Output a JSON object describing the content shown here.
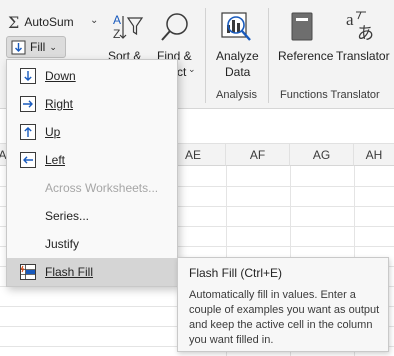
{
  "ribbon": {
    "autosum_label": "AutoSum",
    "fill_label": "Fill",
    "sort_label": "Sort &",
    "find_label": "Find &",
    "find_sub": "ct",
    "analyze_line1": "Analyze",
    "analyze_line2": "Data",
    "reference_label": "Reference",
    "translator_label": "Translator",
    "group_analysis": "Analysis",
    "group_functions_translator": "Functions Translator"
  },
  "columns": [
    "AE",
    "AE",
    "AF",
    "AG",
    "AH"
  ],
  "fill_menu": {
    "items": [
      {
        "label": "Down",
        "icon": "fill-down-icon",
        "enabled": true
      },
      {
        "label": "Right",
        "icon": "fill-right-icon",
        "enabled": true
      },
      {
        "label": "Up",
        "icon": "fill-up-icon",
        "enabled": true
      },
      {
        "label": "Left",
        "icon": "fill-left-icon",
        "enabled": true
      },
      {
        "label": "Across Worksheets...",
        "icon": "",
        "enabled": false
      },
      {
        "label": "Series...",
        "icon": "",
        "enabled": true
      },
      {
        "label": "Justify",
        "icon": "",
        "enabled": true
      },
      {
        "label": "Flash Fill",
        "icon": "flash-fill-icon",
        "enabled": true,
        "selected": true
      }
    ]
  },
  "tooltip": {
    "title": "Flash Fill (Ctrl+E)",
    "body": "Automatically fill in values. Enter a couple of examples you want as output and keep the active cell in the column you want filled in."
  },
  "colors": {
    "accent": "#185abd",
    "selection_bg": "#d5d5d5",
    "ribbon_bg": "#f3f3f3"
  }
}
